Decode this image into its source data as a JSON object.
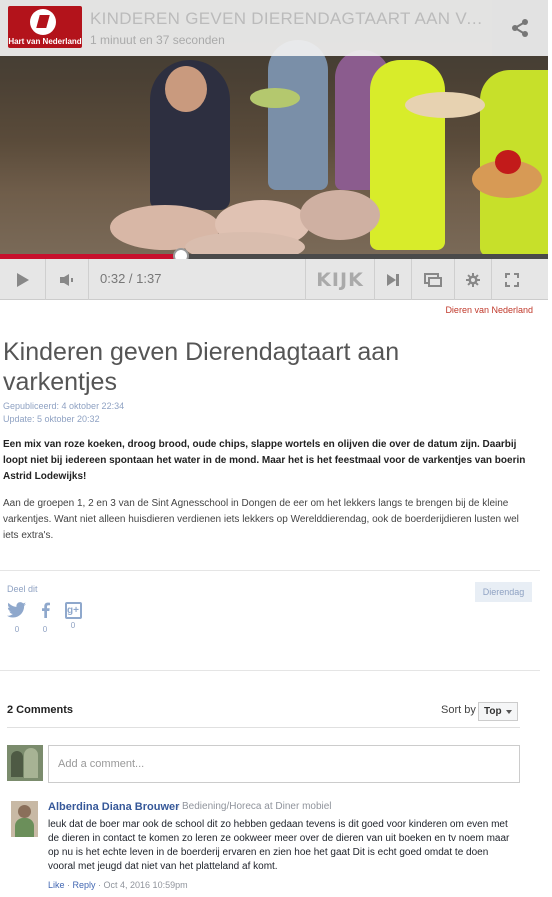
{
  "player": {
    "logo_text": "Hart van Nederland",
    "title": "KINDEREN GEVEN DIERENDAGTAART AAN VARKENTJES",
    "duration_text": "1 minuut en 37 seconden",
    "current_time": "0:32",
    "total_time": "1:37",
    "progress": 0.33,
    "brand_button_label": "KIJK",
    "accent_color": "#c8102e"
  },
  "article": {
    "source_link": "Dieren van Nederland",
    "headline": "Kinderen geven Dierendagtaart aan varkentjes",
    "published": "Gepubliceerd: 4 oktober 22:34",
    "updated": "Update: 5 oktober 20:32",
    "lead": "Een mix van roze koeken, droog brood, oude chips, slappe wortels en olijven die over de datum zijn. Daarbij loopt niet bij iedereen spontaan het water in de mond. Maar het is het feestmaal voor de varkentjes van boerin Astrid Lodewijks!",
    "body": "Aan de groepen 1, 2 en 3 van de Sint Agnesschool in Dongen de eer om het lekkers langs te brengen bij de kleine varkentjes. Want niet alleen huisdieren verdienen iets lekkers op Werelddierendag, ook de boerderijdieren lusten wel iets extra's."
  },
  "share": {
    "label": "Deel dit",
    "twitter_count": "0",
    "facebook_count": "0",
    "googleplus_count": "0",
    "tag": "Dierendag"
  },
  "comments": {
    "count_label": "2 Comments",
    "sort_label": "Sort by",
    "sort_value": "Top",
    "input_placeholder": "Add a comment...",
    "items": [
      {
        "author": "Alberdina Diana Brouwer",
        "role": "Bediening/Horeca at Diner mobiel",
        "text": "leuk dat de boer mar ook de school dit zo hebben gedaan tevens is dit goed voor kinderen om even met de dieren in contact te komen zo leren ze ookweer meer over de dieren van uit boeken en tv noem maar op nu is het echte leven in de boerderij ervaren en zien hoe het gaat Dit is echt goed omdat te doen vooral met jeugd dat niet van het platteland af komt.",
        "like": "Like",
        "reply": "Reply",
        "timestamp": "Oct 4, 2016 10:59pm"
      }
    ]
  }
}
